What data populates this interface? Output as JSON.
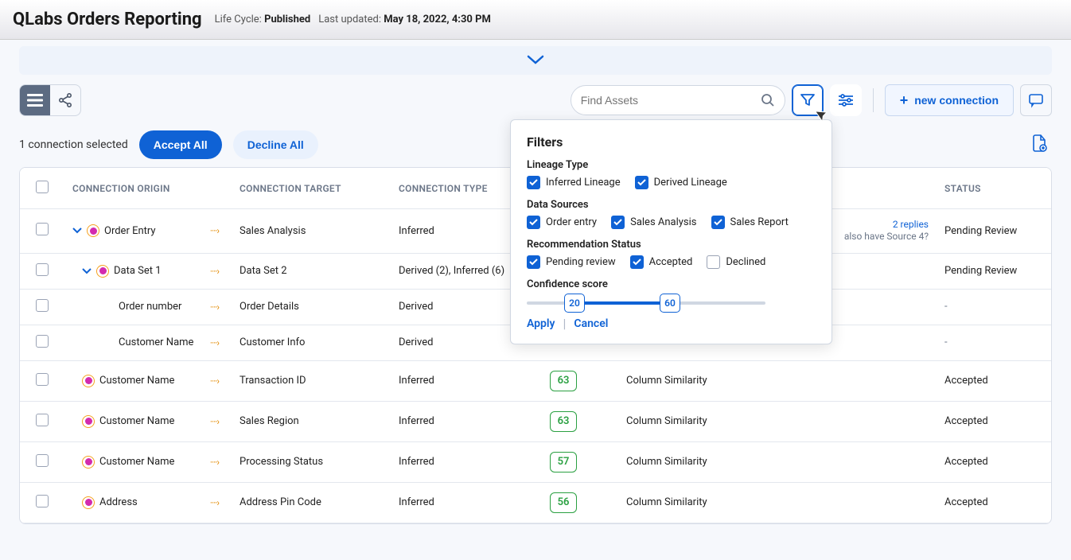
{
  "header": {
    "title": "QLabs Orders Reporting",
    "lifecycle_label": "Life Cycle:",
    "lifecycle_value": "Published",
    "updated_label": "Last updated:",
    "updated_value": "May 18, 2022, 4:30 PM"
  },
  "toolbar": {
    "search_placeholder": "Find Assets",
    "new_connection": "new connection"
  },
  "selection": {
    "text": "1 connection selected",
    "accept": "Accept All",
    "decline": "Decline All"
  },
  "columns": {
    "origin": "CONNECTION ORIGIN",
    "target": "CONNECTION TARGET",
    "type": "CONNECTION TYPE",
    "status": "STATUS"
  },
  "rows": [
    {
      "level": 0,
      "caret": true,
      "dot": true,
      "origin": "Order Entry",
      "target": "Sales Analysis",
      "type": "Inferred",
      "conf": "",
      "basis": "",
      "comments": {
        "replies": "2 replies",
        "extra": "also have Source 4?"
      },
      "status": "Pending Review"
    },
    {
      "level": 1,
      "caret": true,
      "dot": true,
      "origin": "Data Set 1",
      "target": "Data Set 2",
      "type": "Derived (2), Inferred (6)",
      "conf": "",
      "basis": "",
      "comments": null,
      "status": "Pending Review"
    },
    {
      "level": 2,
      "caret": false,
      "dot": false,
      "origin": "Order number",
      "target": "Order Details",
      "type": "Derived",
      "conf": "",
      "basis": "",
      "comments": null,
      "status": "-"
    },
    {
      "level": 2,
      "caret": false,
      "dot": false,
      "origin": "Customer Name",
      "target": "Customer Info",
      "type": "Derived",
      "conf": "",
      "basis": "",
      "comments": null,
      "status": "-"
    },
    {
      "level": 1,
      "caret": false,
      "dot": true,
      "origin": "Customer Name",
      "target": "Transaction ID",
      "type": "Inferred",
      "conf": "63",
      "basis": "Column Similarity",
      "comments": null,
      "status": "Accepted"
    },
    {
      "level": 1,
      "caret": false,
      "dot": true,
      "origin": "Customer Name",
      "target": "Sales Region",
      "type": "Inferred",
      "conf": "63",
      "basis": "Column Similarity",
      "comments": null,
      "status": "Accepted"
    },
    {
      "level": 1,
      "caret": false,
      "dot": true,
      "origin": "Customer Name",
      "target": "Processing Status",
      "type": "Inferred",
      "conf": "57",
      "basis": "Column Similarity",
      "comments": null,
      "status": "Accepted"
    },
    {
      "level": 1,
      "caret": false,
      "dot": true,
      "origin": "Address",
      "target": "Address Pin Code",
      "type": "Inferred",
      "conf": "56",
      "basis": "Column Similarity",
      "comments": null,
      "status": "Accepted"
    }
  ],
  "filters": {
    "heading": "Filters",
    "lineage_label": "Lineage Type",
    "lineage": [
      {
        "label": "Inferred Lineage",
        "checked": true
      },
      {
        "label": "Derived Lineage",
        "checked": true
      }
    ],
    "sources_label": "Data Sources",
    "sources": [
      {
        "label": "Order entry",
        "checked": true
      },
      {
        "label": "Sales Analysis",
        "checked": true
      },
      {
        "label": "Sales Report",
        "checked": true
      }
    ],
    "rec_label": "Recommendation Status",
    "rec_status": [
      {
        "label": "Pending review",
        "checked": true
      },
      {
        "label": "Accepted",
        "checked": true
      },
      {
        "label": "Declined",
        "checked": false
      }
    ],
    "confidence_label": "Confidence score",
    "confidence": {
      "low": "20",
      "high": "60"
    },
    "apply": "Apply",
    "cancel": "Cancel"
  }
}
